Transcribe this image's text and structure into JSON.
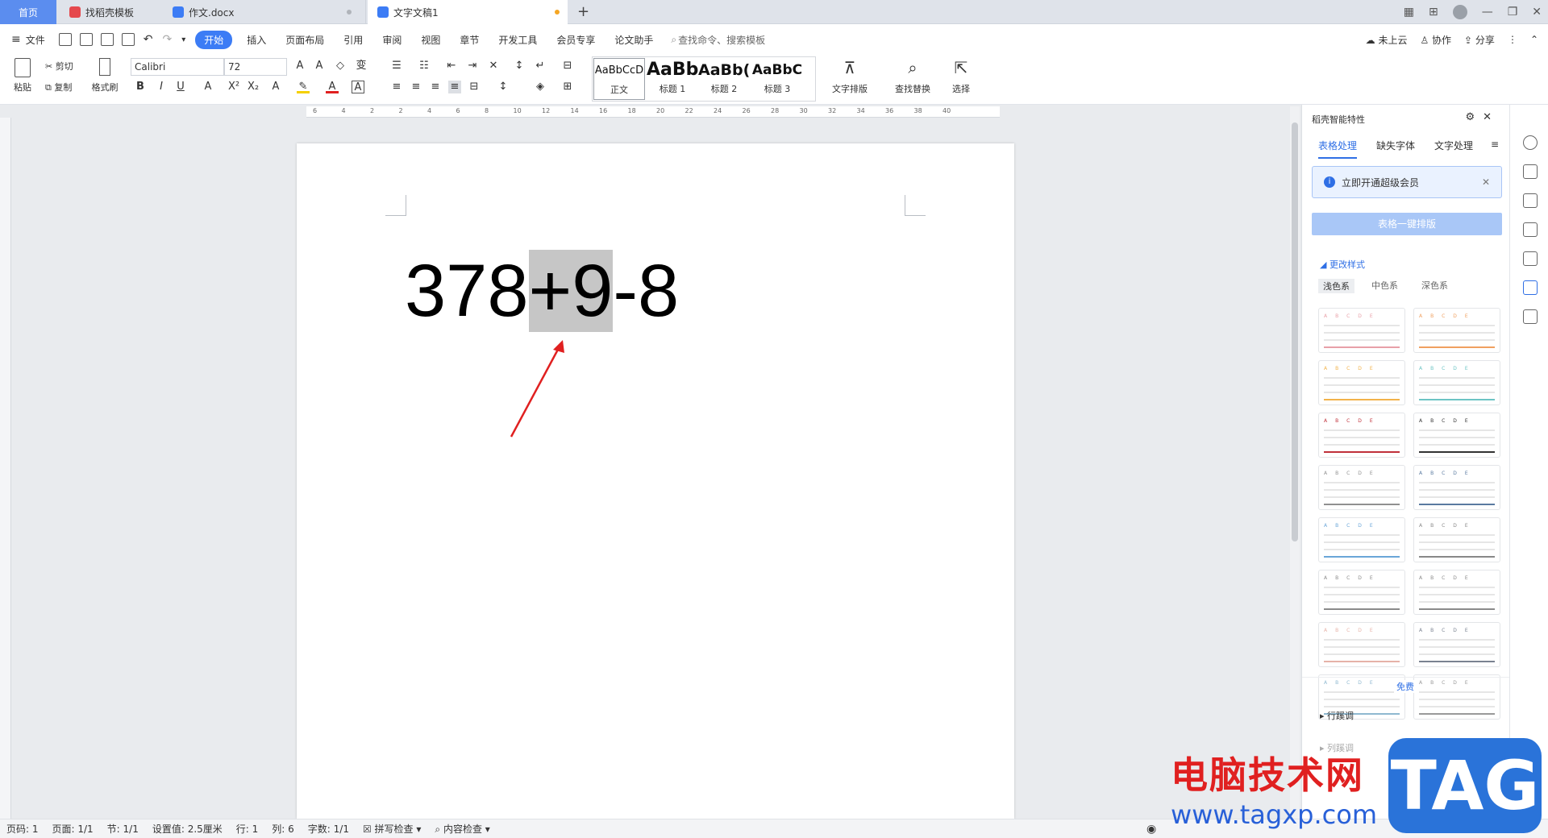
{
  "tabs": {
    "home": "首页",
    "t1": "找稻壳模板",
    "t2": "作文.docx",
    "t3": "文字文稿1"
  },
  "menu": {
    "file": "文件",
    "items": [
      "开始",
      "插入",
      "页面布局",
      "引用",
      "审阅",
      "视图",
      "章节",
      "开发工具",
      "会员专享",
      "论文助手"
    ],
    "search": "查找命令、搜索模板",
    "cloud": "未上云",
    "collab": "协作",
    "share": "分享"
  },
  "ribbon": {
    "paste": "粘贴",
    "cut": "剪切",
    "copy": "复制",
    "format_painter": "格式刷",
    "font_name": "Calibri",
    "font_size": "72",
    "styles": [
      {
        "preview": "AaBbCcD",
        "label": "正文"
      },
      {
        "preview": "AaBb",
        "label": "标题 1"
      },
      {
        "preview": "AaBb(",
        "label": "标题 2"
      },
      {
        "preview": "AaBbC",
        "label": "标题 3"
      }
    ],
    "text_layout": "文字排版",
    "find_replace": "查找替换",
    "select": "选择"
  },
  "ruler_labels": [
    "6",
    "4",
    "2",
    "2",
    "4",
    "6",
    "8",
    "10",
    "12",
    "14",
    "16",
    "18",
    "20",
    "22",
    "24",
    "26",
    "28",
    "30",
    "32",
    "34",
    "36",
    "38",
    "40"
  ],
  "document": {
    "before": "378",
    "selected": "+9",
    "after": "-8"
  },
  "panel": {
    "title": "稻壳智能特性",
    "tabs": [
      "表格处理",
      "缺失字体",
      "文字处理"
    ],
    "notice": "立即开通超级会员",
    "one_click": "表格一键排版",
    "section": "更改样式",
    "subtabs": [
      "浅色系",
      "中色系",
      "深色系"
    ],
    "free_badge": "免费",
    "row_adjust": "行蹊调",
    "col_adjust": "列蹊调",
    "header_letters": "ABCDE",
    "theme_colors": [
      "#e8a0a8",
      "#f0a060",
      "#f2b24a",
      "#6cc4c4",
      "#c0303a",
      "#333333",
      "#909090",
      "#5a7aa0",
      "#6aa6d8",
      "#888888",
      "#8a8a8a",
      "#8a8a8a",
      "#e6b2a8",
      "#7a8290",
      "#8fb8d0",
      "#999999"
    ]
  },
  "status": {
    "page": "页码: 1",
    "pages": "页面: 1/1",
    "section": "节: 1/1",
    "setting": "设置值: 2.5厘米",
    "row": "行: 1",
    "col": "列: 6",
    "words": "字数: 1/1",
    "spell": "拼写检查",
    "content": "内容检查"
  },
  "watermark": {
    "text": "电脑技术网",
    "url": "www.tagxp.com",
    "tag": "TAG"
  }
}
